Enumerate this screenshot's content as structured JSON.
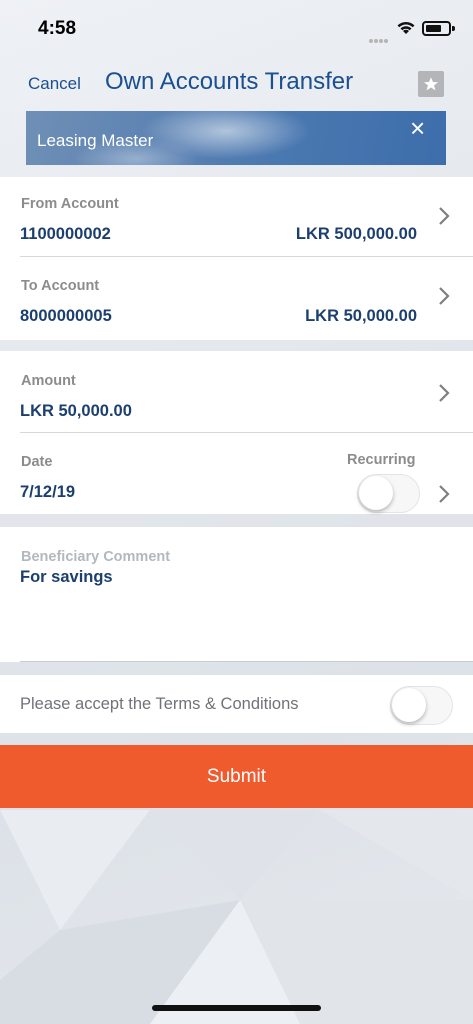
{
  "status_bar": {
    "time": "4:58"
  },
  "nav": {
    "cancel_label": "Cancel",
    "title": "Own Accounts Transfer",
    "favorite_icon": "star-icon"
  },
  "banner": {
    "label": "Leasing Master",
    "close_label": "×"
  },
  "from_account": {
    "label": "From Account",
    "number": "1100000002",
    "balance": "LKR 500,000.00"
  },
  "to_account": {
    "label": "To Account",
    "number": "8000000005",
    "balance": "LKR 50,000.00"
  },
  "amount": {
    "label": "Amount",
    "value": "LKR 50,000.00"
  },
  "date": {
    "label": "Date",
    "value": "7/12/19",
    "recurring_label": "Recurring",
    "recurring_on": false
  },
  "comment": {
    "label": "Beneficiary Comment",
    "value": "For savings"
  },
  "terms": {
    "label": "Please accept the Terms & Conditions",
    "accepted": false
  },
  "submit": {
    "label": "Submit"
  },
  "colors": {
    "accent": "#1a4f90",
    "submit": "#f05b2d",
    "value_text": "#1b3f6e"
  }
}
